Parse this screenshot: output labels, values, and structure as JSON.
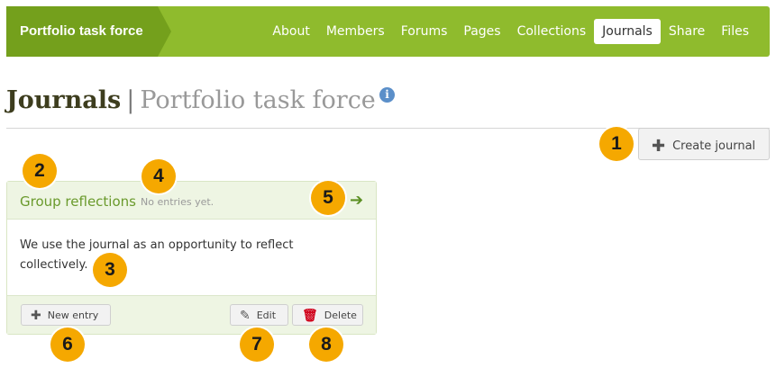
{
  "navbar": {
    "group_name": "Portfolio task force",
    "items": [
      {
        "label": "About",
        "active": false
      },
      {
        "label": "Members",
        "active": false
      },
      {
        "label": "Forums",
        "active": false
      },
      {
        "label": "Pages",
        "active": false
      },
      {
        "label": "Collections",
        "active": false
      },
      {
        "label": "Journals",
        "active": true
      },
      {
        "label": "Share",
        "active": false
      },
      {
        "label": "Files",
        "active": false
      }
    ],
    "bar_color": "#8fbb2d"
  },
  "heading": {
    "title": "Journals",
    "separator": "|",
    "subtitle": "Portfolio task force",
    "info_icon": "i"
  },
  "toolbar": {
    "create_icon": "plus-icon",
    "create_label": "Create journal"
  },
  "journal": {
    "title": "Group reflections",
    "entry_count": "No entries yet.",
    "arrow_icon": "arrow-right-icon",
    "description": "We use the journal as an opportunity to reflect collectively.",
    "new_entry_label": "New entry",
    "edit_label": "Edit",
    "delete_label": "Delete"
  },
  "callouts": [
    "1",
    "2",
    "3",
    "4",
    "5",
    "6",
    "7",
    "8"
  ],
  "colors": {
    "accent": "#8fbb2d",
    "callout": "#f5a800",
    "link": "#6a9a2c",
    "delete": "#d0021b"
  }
}
